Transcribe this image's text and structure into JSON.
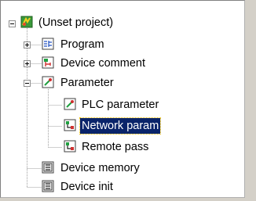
{
  "tree": {
    "root": {
      "label": "(Unset project)",
      "expanded": true
    },
    "items": [
      {
        "label": "Program",
        "icon": "program-icon",
        "expanded": false
      },
      {
        "label": "Device comment",
        "icon": "device-comment-icon",
        "expanded": false
      },
      {
        "label": "Parameter",
        "icon": "parameter-icon",
        "expanded": true,
        "children": [
          {
            "label": "PLC parameter",
            "icon": "plc-parameter-icon"
          },
          {
            "label": "Network param",
            "icon": "network-param-icon",
            "selected": true
          },
          {
            "label": "Remote pass",
            "icon": "remote-pass-icon"
          }
        ]
      },
      {
        "label": "Device memory",
        "icon": "device-memory-icon"
      },
      {
        "label": "Device init",
        "icon": "device-init-icon"
      }
    ],
    "selection_color": "#0a246a"
  }
}
